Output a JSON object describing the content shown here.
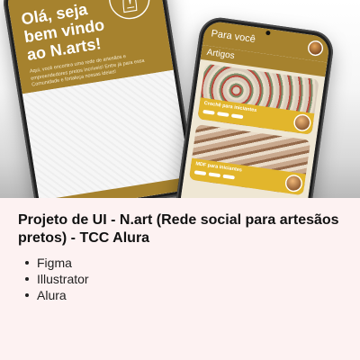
{
  "hero": {
    "welcome_screen": {
      "title": "Olá, seja bem vindo ao N.arts!",
      "text": "Aqui, você encontra uma rede de artesãos e empreendedores pretos incríveis! Entre já para essa Comunidade e fortaleça nossas ideias!"
    },
    "feed_screen": {
      "header_title": "Para você",
      "section_title": "Artigos",
      "cards": [
        {
          "label": "Crochê para iniciantes"
        },
        {
          "label": "MDF para iniciantes"
        }
      ]
    },
    "colors": {
      "brand": "#a6822e",
      "accent": "#e2b62c"
    }
  },
  "project": {
    "title": "Projeto de UI - N.art (Rede social para artesãos pretos) - TCC Alura",
    "tools": [
      "Figma",
      "Illustrator",
      "Alura"
    ]
  }
}
